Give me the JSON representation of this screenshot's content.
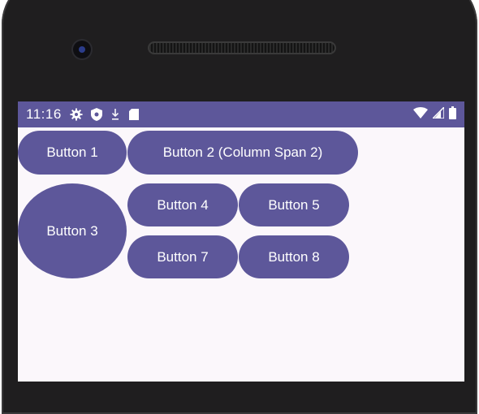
{
  "statusbar": {
    "time": "11:16",
    "icons": [
      "gear-icon",
      "shield-icon",
      "download-icon",
      "sd-card-icon",
      "wifi-icon",
      "cellular-signal-icon",
      "battery-icon"
    ]
  },
  "colors": {
    "primary": "#5d579a",
    "screen_bg": "#fbf7fb",
    "bezel": "#1f1e1f"
  },
  "buttons": {
    "b1": "Button 1",
    "b2": "Button 2 (Column Span 2)",
    "b3": "Button 3",
    "b4": "Button 4",
    "b5": "Button 5",
    "b7": "Button 7",
    "b8": "Button 8"
  }
}
